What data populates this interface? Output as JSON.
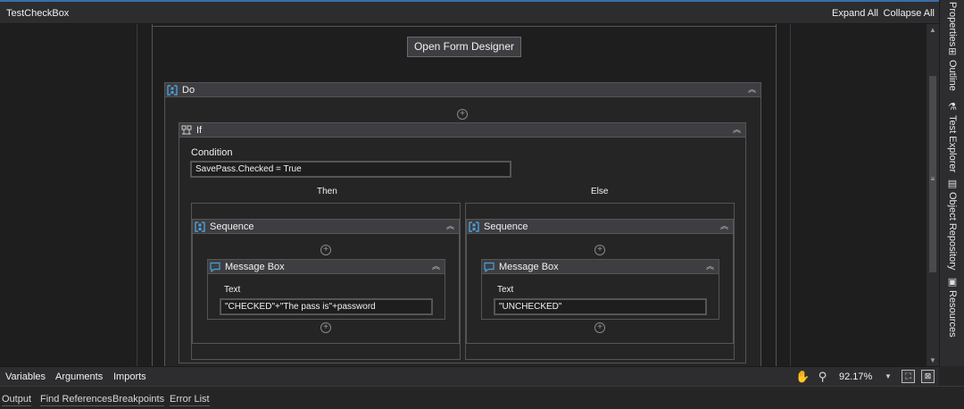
{
  "tab": {
    "title": "TestCheckBox",
    "expand_all": "Expand All",
    "collapse_all": "Collapse All"
  },
  "right_tabs": [
    "Properties",
    "Outline",
    "Test Explorer",
    "Object Repository",
    "Resources"
  ],
  "designer": {
    "open_form_designer": "Open Form Designer",
    "do": {
      "title": "Do"
    },
    "if": {
      "title": "If",
      "condition_label": "Condition",
      "condition_value": "SavePass.Checked = True",
      "then_label": "Then",
      "else_label": "Else",
      "then_seq": {
        "title": "Sequence",
        "msg": {
          "title": "Message Box",
          "text_label": "Text",
          "text_value": "\"CHECKED\"+\"The pass is\"+password"
        }
      },
      "else_seq": {
        "title": "Sequence",
        "msg": {
          "title": "Message Box",
          "text_label": "Text",
          "text_value": "\"UNCHECKED\""
        }
      }
    }
  },
  "bottom_bar": {
    "variables": "Variables",
    "arguments": "Arguments",
    "imports": "Imports",
    "zoom": "92.17%"
  },
  "panels": [
    "Output",
    "Find References",
    "Breakpoints",
    "Error List"
  ],
  "colors": {
    "accent": "#3a6ea5",
    "icon_blue": "#4a9fd8"
  }
}
